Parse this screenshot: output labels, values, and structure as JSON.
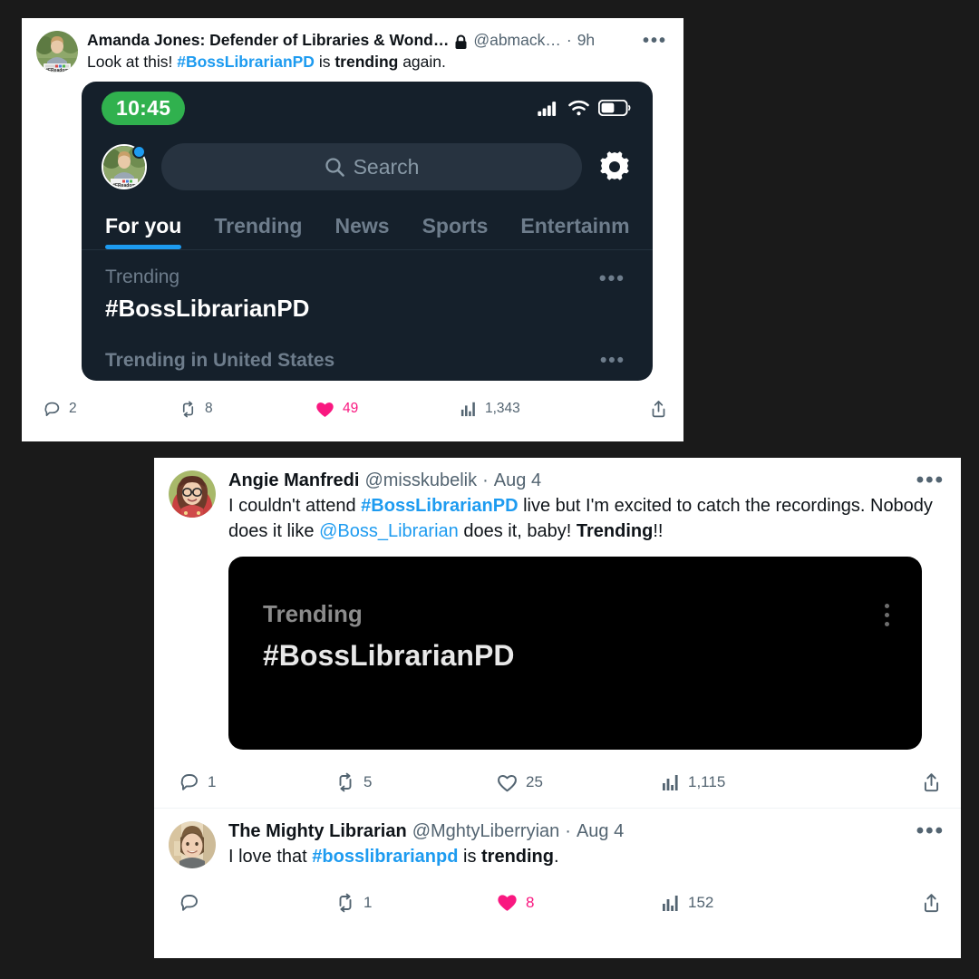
{
  "background_color": "#1a1a1a",
  "colors": {
    "link_blue": "#1D9BF0",
    "like_pink": "#F91880",
    "text_primary": "#0F1419",
    "text_secondary": "#536471",
    "card_white": "#FFFFFF",
    "phone_navy": "#15202B",
    "black_card": "#000000",
    "recording_green": "#30B14E"
  },
  "tweets": [
    {
      "id": "tweet-amanda-jones",
      "display_name": "Amanda Jones: Defender of Libraries & Wond…",
      "protected_icon": "lock-icon",
      "handle": "@abmack…",
      "separator": "·",
      "timestamp": "9h",
      "more_label": "•••",
      "text_parts": [
        {
          "t": "Look at this! ",
          "style": "normal"
        },
        {
          "t": "#BossLibrarianPD",
          "style": "link"
        },
        {
          "t": " is ",
          "style": "normal"
        },
        {
          "t": "trending",
          "style": "bold"
        },
        {
          "t": " again.",
          "style": "normal"
        }
      ],
      "avatar_name": "avatar-amanda-jones",
      "actions": {
        "reply": "2",
        "repost": "8",
        "like": "49",
        "liked": true,
        "views": "1,343"
      }
    },
    {
      "id": "tweet-angie-manfredi",
      "display_name": "Angie Manfredi",
      "handle": "@misskubelik",
      "separator": "·",
      "timestamp": "Aug 4",
      "more_label": "•••",
      "text_parts": [
        {
          "t": "I couldn't attend ",
          "style": "normal"
        },
        {
          "t": "#BossLibrarianPD",
          "style": "link"
        },
        {
          "t": " live but I'm excited to catch the recordings. Nobody does it like ",
          "style": "normal"
        },
        {
          "t": "@Boss_Librarian",
          "style": "link-plain"
        },
        {
          "t": " does it, baby! ",
          "style": "normal"
        },
        {
          "t": "Trending",
          "style": "bold"
        },
        {
          "t": "!!",
          "style": "normal"
        }
      ],
      "avatar_name": "avatar-angie-manfredi",
      "actions": {
        "reply": "1",
        "repost": "5",
        "like": "25",
        "liked": false,
        "views": "1,115"
      }
    },
    {
      "id": "tweet-mighty-librarian",
      "display_name": "The Mighty Librarian",
      "handle": "@MghtyLiberryian",
      "separator": "·",
      "timestamp": "Aug 4",
      "more_label": "•••",
      "text_parts": [
        {
          "t": "I love that ",
          "style": "normal"
        },
        {
          "t": "#bosslibrarianpd",
          "style": "link"
        },
        {
          "t": " is ",
          "style": "normal"
        },
        {
          "t": "trending",
          "style": "bold"
        },
        {
          "t": ".",
          "style": "normal"
        }
      ],
      "avatar_name": "avatar-mighty-librarian",
      "actions": {
        "reply": "",
        "repost": "1",
        "like": "8",
        "liked": true,
        "views": "152"
      }
    }
  ],
  "phone_embed": {
    "status_bar": {
      "time": "10:45",
      "icons": [
        "cellular-signal-icon",
        "wifi-icon",
        "battery-icon"
      ]
    },
    "search_placeholder": "Search",
    "search_icon": "search-icon",
    "settings_icon": "gear-icon",
    "avatar_badge": "unread-badge",
    "tabs": [
      {
        "label": "For you",
        "active": true
      },
      {
        "label": "Trending",
        "active": false
      },
      {
        "label": "News",
        "active": false
      },
      {
        "label": "Sports",
        "active": false
      },
      {
        "label": "Entertainm",
        "active": false
      }
    ],
    "trend_items": [
      {
        "label": "Trending",
        "tag": "#BossLibrarianPD",
        "more": "•••"
      },
      {
        "label": "Trending in United States",
        "more": "•••"
      }
    ]
  },
  "black_card": {
    "label": "Trending",
    "tag": "#BossLibrarianPD",
    "more_icon": "kebab-menu-icon"
  },
  "action_icons": {
    "reply": "reply-icon",
    "repost": "repost-icon",
    "like": "heart-icon",
    "views": "views-bar-chart-icon",
    "share": "share-icon"
  }
}
